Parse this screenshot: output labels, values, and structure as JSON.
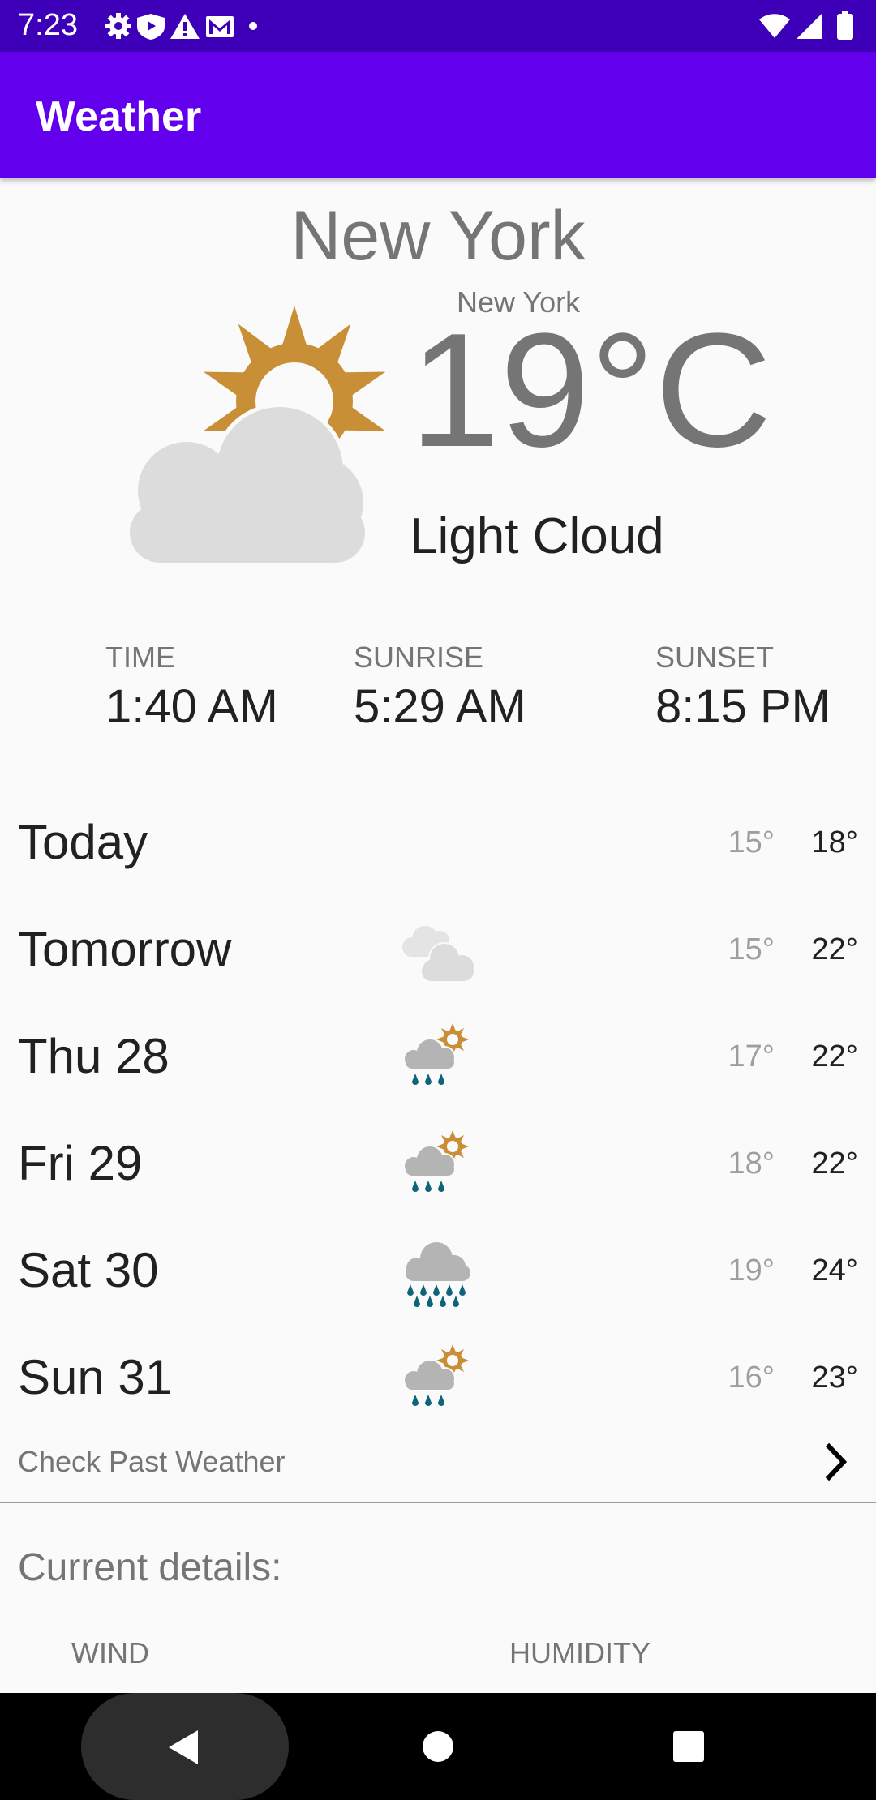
{
  "status_bar": {
    "time": "7:23",
    "left_icons": [
      "gear-icon",
      "shield-icon",
      "warning-icon",
      "gmail-icon",
      "dot-icon"
    ],
    "right_icons": [
      "wifi-icon",
      "cell-signal-icon",
      "battery-icon"
    ]
  },
  "app_bar": {
    "title": "Weather"
  },
  "current": {
    "city": "New York",
    "location": "New York",
    "temperature": "19°C",
    "condition": "Light Cloud",
    "icon": "light-cloud-icon"
  },
  "sun_info": [
    {
      "label": "TIME",
      "value": "1:40 AM"
    },
    {
      "label": "SUNRISE",
      "value": "5:29 AM"
    },
    {
      "label": "SUNSET",
      "value": "8:15 PM"
    }
  ],
  "forecast": [
    {
      "day": "Today",
      "icon": "none",
      "low": "15°",
      "high": "18°"
    },
    {
      "day": "Tomorrow",
      "icon": "heavy-cloud-icon",
      "low": "15°",
      "high": "22°"
    },
    {
      "day": "Thu 28",
      "icon": "showers-icon",
      "low": "17°",
      "high": "22°"
    },
    {
      "day": "Fri 29",
      "icon": "showers-icon",
      "low": "18°",
      "high": "22°"
    },
    {
      "day": "Sat 30",
      "icon": "heavy-rain-icon",
      "low": "19°",
      "high": "24°"
    },
    {
      "day": "Sun 31",
      "icon": "showers-icon",
      "low": "16°",
      "high": "23°"
    }
  ],
  "past_weather": {
    "label": "Check Past Weather"
  },
  "details": {
    "title": "Current details:",
    "items": [
      {
        "label": "WIND"
      },
      {
        "label": "HUMIDITY"
      }
    ]
  },
  "colors": {
    "status_bar": "#3d00b8",
    "app_bar": "#6200ee",
    "sun": "#c88f36",
    "cloud": "#dcdcdc",
    "rain_cloud": "#b4b4b4",
    "rain": "#0e6478"
  }
}
